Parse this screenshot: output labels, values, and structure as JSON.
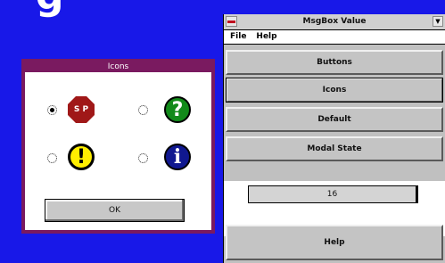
{
  "background": {
    "title_fragment": "g"
  },
  "icons_dialog": {
    "title": "Icons",
    "options": [
      {
        "icon": "stop-icon",
        "label": "S P",
        "selected": true
      },
      {
        "icon": "question-icon",
        "label": "?",
        "selected": false
      },
      {
        "icon": "exclamation-icon",
        "label": "!",
        "selected": false
      },
      {
        "icon": "information-icon",
        "label": "i",
        "selected": false
      }
    ],
    "ok_label": "OK"
  },
  "msgbox_window": {
    "title": "MsgBox Value",
    "menu": [
      "File",
      "Help"
    ],
    "buttons": [
      "Buttons",
      "Icons",
      "Default",
      "Modal State"
    ],
    "value": "16",
    "help_label": "Help"
  },
  "colors": {
    "desktop": "#1818e8",
    "dialog_frame": "#7a1a60",
    "stop": "#a01818",
    "question": "#128a1a",
    "exclamation": "#ffee00",
    "info": "#101890"
  }
}
